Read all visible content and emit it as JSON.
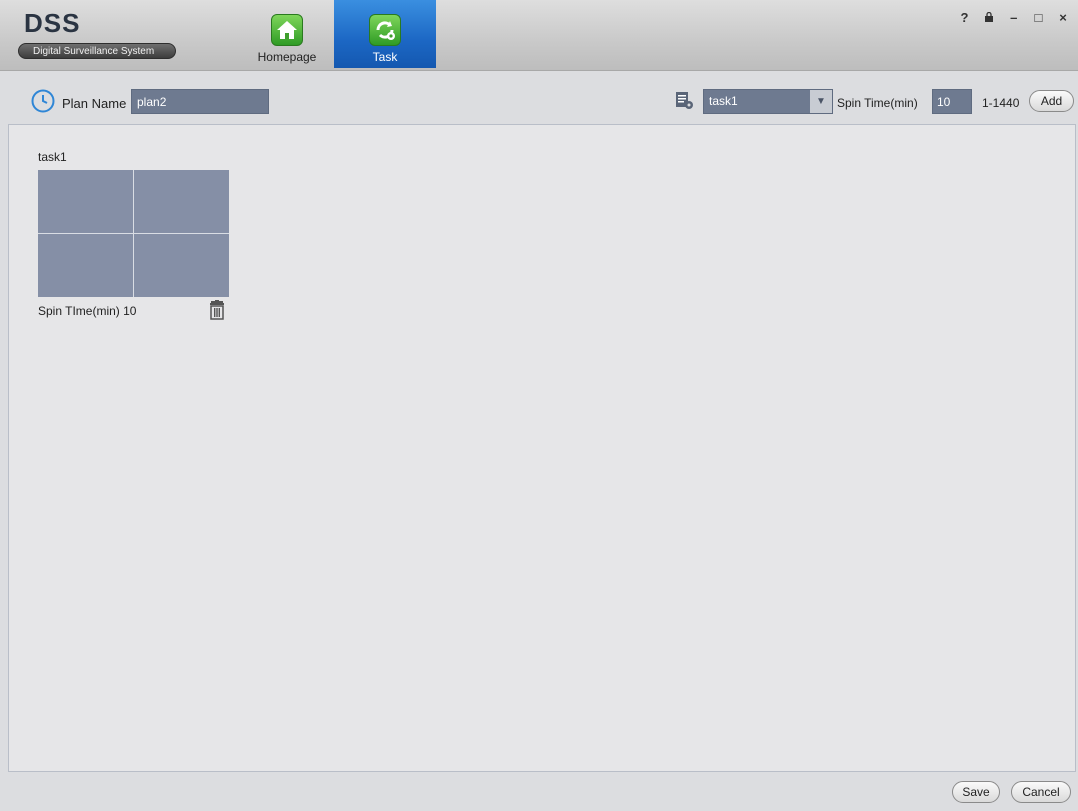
{
  "app": {
    "logo": "DSS",
    "subtitle": "Digital Surveillance System"
  },
  "tabs": [
    {
      "label": "Homepage",
      "icon": "home-icon",
      "active": false
    },
    {
      "label": "Task",
      "icon": "task-gear-icon",
      "active": true
    }
  ],
  "window_controls": {
    "help": "?",
    "lock": "🔒",
    "minimize": "–",
    "maximize": "□",
    "close": "×"
  },
  "toolbar": {
    "plan_label": "Plan Name",
    "plan_value": "plan2",
    "task_select_value": "task1",
    "spin_label": "Spin Time(min)",
    "spin_value": "10",
    "range": "1-1440",
    "add_label": "Add"
  },
  "task_card": {
    "title": "task1",
    "spin_text": "Spin TIme(min) 10"
  },
  "footer": {
    "save_label": "Save",
    "cancel_label": "Cancel"
  },
  "colors": {
    "accent": "#1c67c4",
    "input_bg": "#6e7a90",
    "grid_cell": "#858fa6"
  }
}
